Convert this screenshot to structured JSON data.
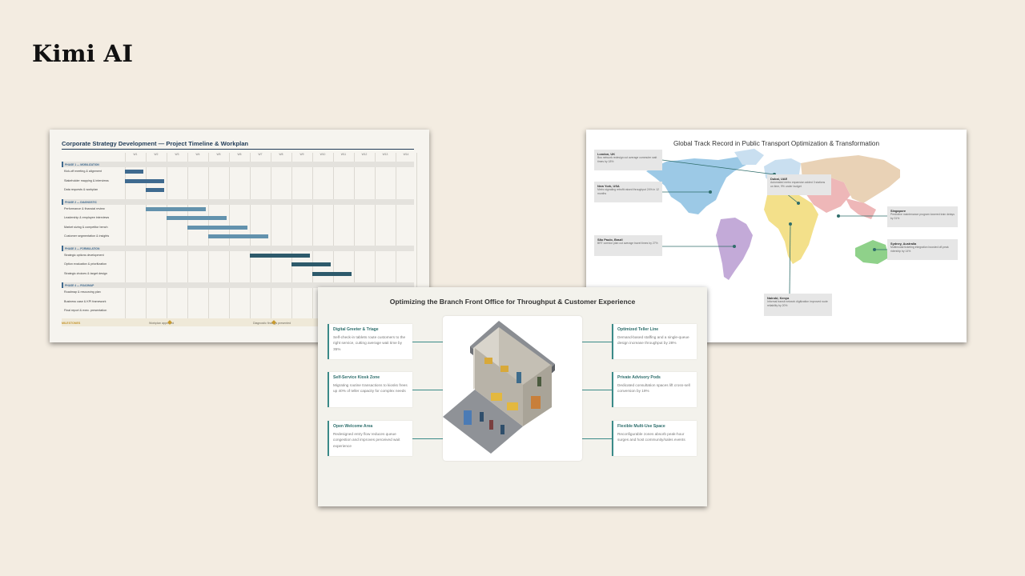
{
  "brand": "Kimi AI",
  "gantt": {
    "title": "Corporate Strategy Development — Project Timeline & Workplan",
    "weeks": [
      "W1",
      "W2",
      "W3",
      "W4",
      "W5",
      "W6",
      "W7",
      "W8",
      "W9",
      "W10",
      "W11",
      "W12",
      "W13",
      "W14"
    ],
    "phases": [
      {
        "label": "PHASE 1 — MOBILIZATION",
        "tasks": [
          {
            "label": "Kick-off meeting & alignment",
            "start": 0,
            "end": 0.9
          },
          {
            "label": "Stakeholder mapping & interviews",
            "start": 0,
            "end": 1.9
          },
          {
            "label": "Data requests & workplan",
            "start": 1,
            "end": 1.9
          }
        ]
      },
      {
        "label": "PHASE 2 — DIAGNOSTIC",
        "tasks": [
          {
            "label": "Performance & financial review",
            "start": 1,
            "end": 3.9
          },
          {
            "label": "Leadership & employee interviews",
            "start": 2,
            "end": 4.9
          },
          {
            "label": "Market sizing & competitor bench",
            "start": 3,
            "end": 5.9
          },
          {
            "label": "Customer segmentation & insights",
            "start": 4,
            "end": 6.9
          }
        ]
      },
      {
        "label": "PHASE 3 — FORMULATION",
        "tasks": [
          {
            "label": "Strategic options development",
            "start": 6,
            "end": 8.9
          },
          {
            "label": "Option evaluation & prioritization",
            "start": 8,
            "end": 9.9
          },
          {
            "label": "Strategic choices & target design",
            "start": 9,
            "end": 10.9
          }
        ]
      },
      {
        "label": "PHASE 4 — ROADMAP",
        "tasks": [
          {
            "label": "Roadmap & resourcing plan",
            "start": null,
            "end": null
          },
          {
            "label": "Business case & KPI framework",
            "start": null,
            "end": null
          },
          {
            "label": "Final report & exec. presentation",
            "start": null,
            "end": null
          }
        ]
      }
    ],
    "milestones_label": "MILESTONES",
    "milestones": [
      {
        "label": "Workplan approved",
        "week": 2
      },
      {
        "label": "Diagnostic findings presented",
        "week": 7
      }
    ],
    "colors": {
      "phase1": "#3f6a8f",
      "phase2": "#6392ad",
      "phase3": "#2d5a6b",
      "milestone": "#c99a2c"
    }
  },
  "map": {
    "title": "Global Track Record in Public Transport Optimization & Transformation",
    "cities": [
      {
        "city": "London, UK",
        "desc": "Bus network redesign cut average commuter wait times by 18%"
      },
      {
        "city": "New York, USA",
        "desc": "Metro signaling retrofit raised throughput 24% in 12 months"
      },
      {
        "city": "São Paulo, Brazil",
        "desc": "BRT corridor plan cut average travel times by 27%"
      },
      {
        "city": "Dubai, UAE",
        "desc": "Automated metro expansion added 3 stations on time, 9% under budget"
      },
      {
        "city": "Singapore",
        "desc": "Predictive maintenance program lowered train delays by 31%"
      },
      {
        "city": "Sydney, Australia",
        "desc": "Multimodal ticketing integration boosted off-peak ridership by 14%"
      },
      {
        "city": "Nairobi, Kenya",
        "desc": "Informal transit network digitization improved route reliability by 20%"
      }
    ],
    "region_colors": {
      "north_america": "#9cc9e6",
      "south_america": "#c3aad8",
      "europe": "#c9dff0",
      "africa": "#f3e08a",
      "middle_east": "#eeb7b8",
      "asia": "#e9d2b6",
      "oceania": "#8fd18a",
      "marker": "#2f6d6a"
    }
  },
  "branch": {
    "title": "Optimizing the Branch Front Office for Throughput & Customer Experience",
    "left": [
      {
        "title": "Digital Greeter & Triage",
        "desc": "Self-check-in tablets route customers to the right service, cutting average wait time by 35%"
      },
      {
        "title": "Self-Service Kiosk Zone",
        "desc": "Migrating routine transactions to kiosks frees up 40% of teller capacity for complex needs"
      },
      {
        "title": "Open Welcome Area",
        "desc": "Redesigned entry flow reduces queue congestion and improves perceived wait experience"
      }
    ],
    "right": [
      {
        "title": "Optimized Teller Line",
        "desc": "Demand-based staffing and a single-queue design increase throughput by 28%"
      },
      {
        "title": "Private Advisory Pods",
        "desc": "Dedicated consultation spaces lift cross-sell conversion by 19%"
      },
      {
        "title": "Flexible Multi-Use Space",
        "desc": "Reconfigurable zones absorb peak-hour surges and host community/sales events"
      }
    ],
    "accent": "#2d6e6c"
  }
}
